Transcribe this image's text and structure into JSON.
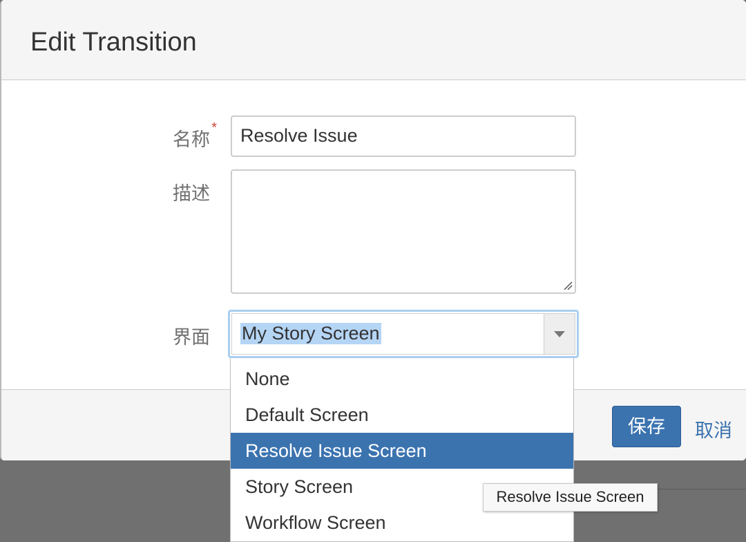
{
  "dialog": {
    "title": "Edit Transition"
  },
  "form": {
    "name_label": "名称",
    "required_marker": "*",
    "name_value": "Resolve Issue",
    "description_label": "描述",
    "description_value": "",
    "screen_label": "界面",
    "screen_selected": "My Story Screen"
  },
  "dropdown": {
    "options": [
      "None",
      "Default Screen",
      "Resolve Issue Screen",
      "Story Screen",
      "Workflow Screen"
    ],
    "highlighted_index": 2
  },
  "tooltip": {
    "text": "Resolve Issue Screen"
  },
  "footer": {
    "save_label": "保存",
    "cancel_label": "取消"
  },
  "colors": {
    "primary": "#3b73af",
    "required": "#d04437",
    "focus": "#a9cef0",
    "selection": "#b5d5f5"
  },
  "icons": {
    "select_arrow": "chevron-down-icon",
    "resize_grip": "resize-grip-icon"
  }
}
